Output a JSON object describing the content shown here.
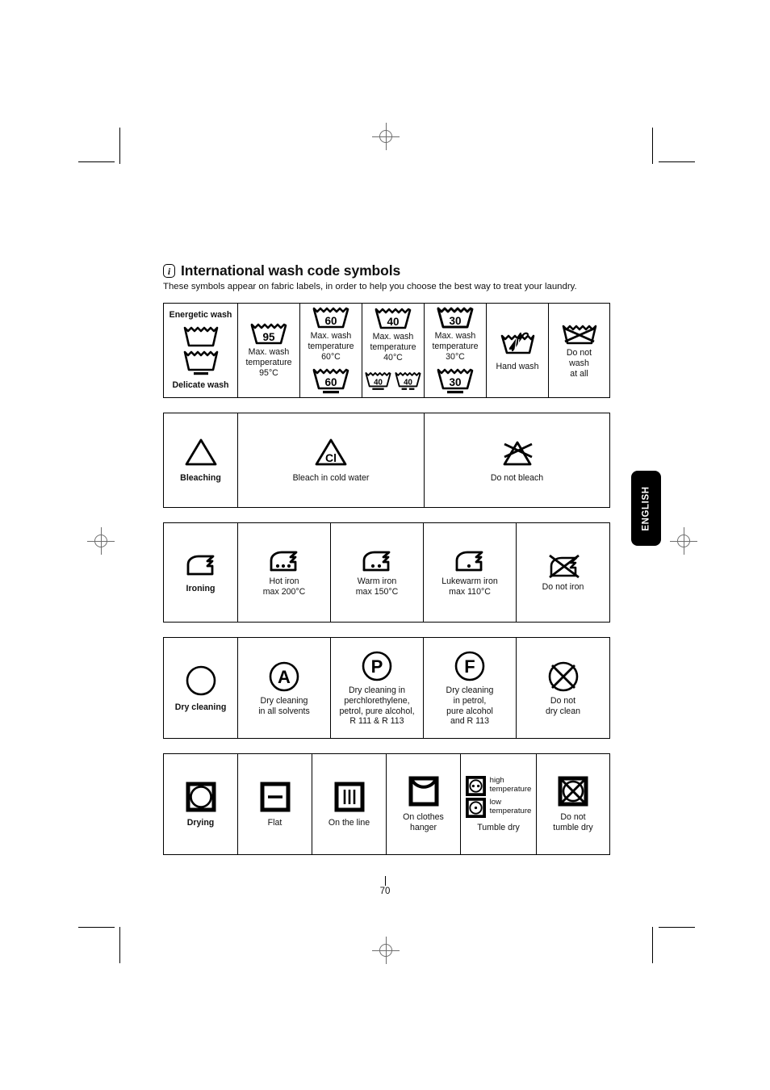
{
  "document": {
    "heading": "International wash code symbols",
    "info_icon": "i",
    "subheading": "These symbols appear on fabric labels, in order to help you choose the best way to treat your laundry.",
    "page_number": "70",
    "language_tab": "ENGLISH"
  },
  "washing": {
    "label_top": "Energetic wash",
    "label_bottom": "Delicate wash",
    "cells": [
      {
        "temp": "95",
        "caption": "Max. wash\ntemperature\n95°C",
        "caption_lines": [
          "Max. wash",
          "temperature",
          "95°C"
        ],
        "delicate": []
      },
      {
        "temp": "60",
        "caption_lines": [
          "Max. wash",
          "temperature",
          "60°C"
        ],
        "delicate": [
          "60"
        ]
      },
      {
        "temp": "40",
        "caption_lines": [
          "Max. wash",
          "temperature",
          "40°C"
        ],
        "delicate": [
          "40",
          "40"
        ]
      },
      {
        "temp": "30",
        "caption_lines": [
          "Max. wash",
          "temperature",
          "30°C"
        ],
        "delicate": [
          "30"
        ]
      }
    ],
    "hand_wash": "Hand wash",
    "do_not_wash_lines": [
      "Do not",
      "wash",
      "at all"
    ]
  },
  "bleaching": {
    "label": "Bleaching",
    "cold_water": "Bleach in cold water",
    "cold_water_mark": "Cl",
    "do_not_bleach": "Do not bleach"
  },
  "ironing": {
    "label": "Ironing",
    "hot": [
      "Hot iron",
      "max 200°C"
    ],
    "warm": [
      "Warm iron",
      "max 150°C"
    ],
    "lukewarm": [
      "Lukewarm iron",
      "max 110°C"
    ],
    "do_not_iron": "Do not iron"
  },
  "dry_cleaning": {
    "label": "Dry cleaning",
    "all_solvents": [
      "Dry cleaning",
      "in all solvents"
    ],
    "all_solvents_mark": "A",
    "perchlorethylene": [
      "Dry cleaning in",
      "perchlorethylene,",
      "petrol, pure alcohol,",
      "R 111 & R 113"
    ],
    "perchlorethylene_mark": "P",
    "petrol": [
      "Dry cleaning",
      "in petrol,",
      "pure alcohol",
      "and R 113"
    ],
    "petrol_mark": "F",
    "do_not_dry_clean": [
      "Do not",
      "dry clean"
    ]
  },
  "drying": {
    "label": "Drying",
    "flat": "Flat",
    "on_the_line": "On the line",
    "on_clothes_hanger": [
      "On clothes",
      "hanger"
    ],
    "tumble_dry": "Tumble dry",
    "tumble_high": [
      "high",
      "temperature"
    ],
    "tumble_low": [
      "low",
      "temperature"
    ],
    "do_not_tumble_dry": [
      "Do not",
      "tumble dry"
    ]
  },
  "colors": {
    "ink": "#000000",
    "paper": "#ffffff",
    "tab_bg": "#000000",
    "tab_text": "#ffffff",
    "regmark": "#6e6e6e"
  }
}
